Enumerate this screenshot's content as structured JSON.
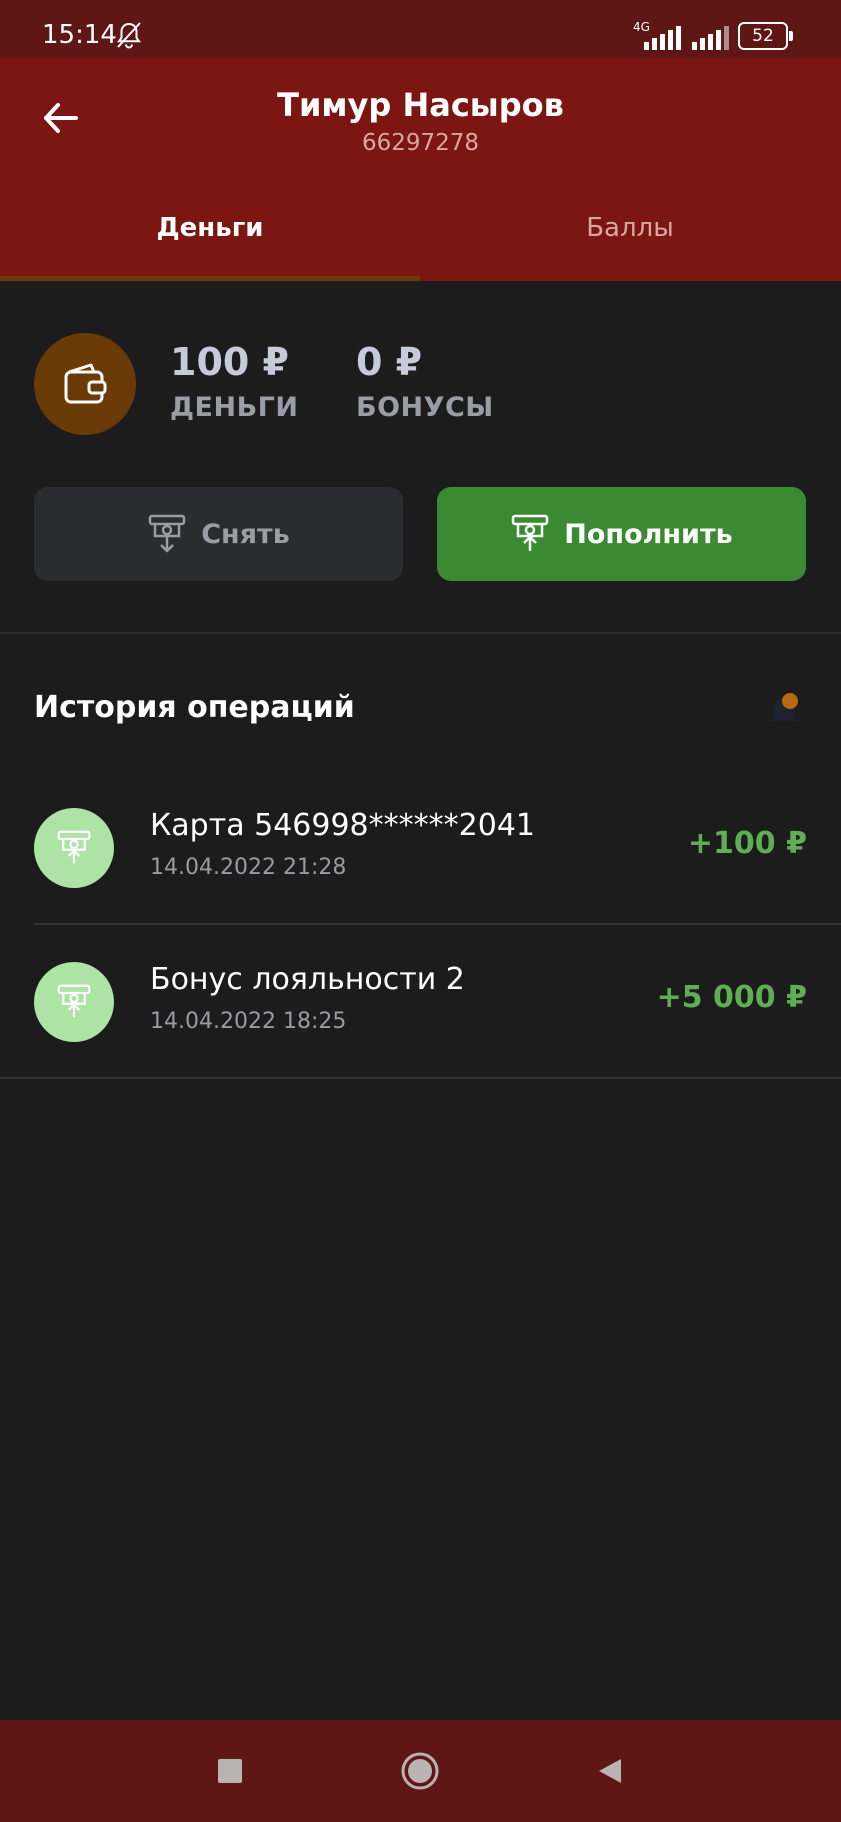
{
  "status_bar": {
    "time": "15:14",
    "network": "4G",
    "battery": "52",
    "icons": [
      "bell-off-icon",
      "signal-icon",
      "signal-icon",
      "battery-icon"
    ]
  },
  "header": {
    "back_icon": "arrow-left-icon",
    "name": "Тимур Насыров",
    "id": "66297278"
  },
  "tabs": [
    {
      "label": "Деньги",
      "active": true
    },
    {
      "label": "Баллы",
      "active": false
    }
  ],
  "balance": {
    "icon": "wallet-icon",
    "money_value": "100 ₽",
    "money_label": "ДЕНЬГИ",
    "bonus_value": "0 ₽",
    "bonus_label": "БОНУСЫ"
  },
  "actions": {
    "withdraw_label": "Снять",
    "deposit_label": "Пополнить",
    "withdraw_icon": "atm-withdraw-icon",
    "deposit_icon": "atm-deposit-icon"
  },
  "history": {
    "title": "История операций",
    "filter_icon": "bell-icon",
    "operations": [
      {
        "title": "Карта 546998******2041",
        "date": "14.04.2022 21:28",
        "amount": "+100 ₽",
        "icon": "atm-deposit-icon"
      },
      {
        "title": "Бонус лояльности 2",
        "date": "14.04.2022 18:25",
        "amount": "+5 000 ₽",
        "icon": "atm-deposit-icon"
      }
    ]
  },
  "nav_bar": {
    "icons": [
      "square-icon",
      "circle-icon",
      "triangle-back-icon"
    ]
  },
  "colors": {
    "header": "#7c1613",
    "status_bar": "#5e1715",
    "background": "#1c1c1c",
    "deposit_button": "#3a8a31",
    "withdraw_button": "#2b2c2f",
    "amount_positive": "#5fae54",
    "op_icon_bg": "#aee3a6",
    "wallet_bg": "#6a3a07"
  }
}
